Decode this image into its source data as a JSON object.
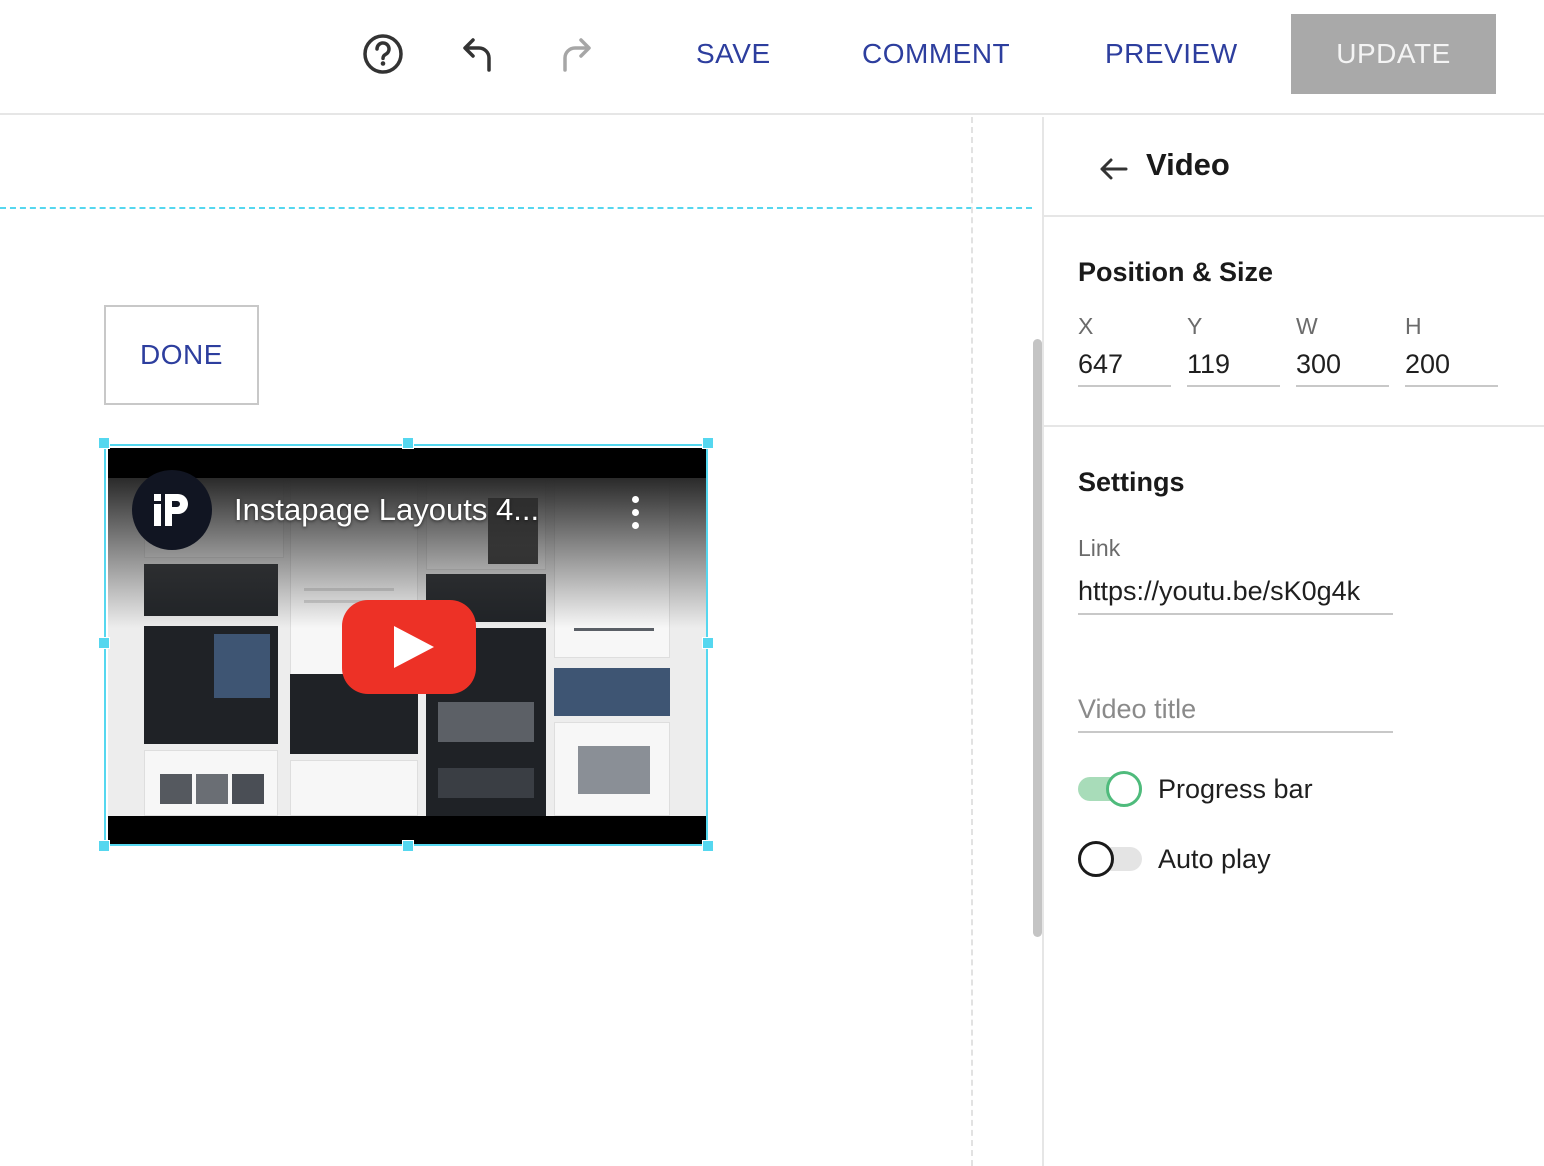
{
  "toolbar": {
    "help_icon": "help-circle-icon",
    "undo_icon": "undo-icon",
    "redo_icon": "redo-icon",
    "save_label": "SAVE",
    "comment_label": "COMMENT",
    "preview_label": "PREVIEW",
    "update_label": "UPDATE"
  },
  "canvas": {
    "done_label": "DONE",
    "video": {
      "title": "Instapage Layouts 4...",
      "channel_icon": "instapage-logo-icon",
      "play_icon": "youtube-play-icon"
    }
  },
  "panel": {
    "back_icon": "arrow-left-icon",
    "title": "Video",
    "position_size": {
      "title": "Position & Size",
      "fields": [
        {
          "label": "X",
          "value": "647"
        },
        {
          "label": "Y",
          "value": "119"
        },
        {
          "label": "W",
          "value": "300"
        },
        {
          "label": "H",
          "value": "200"
        }
      ]
    },
    "settings": {
      "title": "Settings",
      "link_label": "Link",
      "link_value": "https://youtu.be/sK0g4k",
      "video_title_placeholder": "Video title",
      "video_title_value": "",
      "toggles": [
        {
          "label": "Progress bar",
          "on": true
        },
        {
          "label": "Auto play",
          "on": false
        }
      ]
    }
  },
  "colors": {
    "accent_text": "#2d3e9e",
    "selection": "#55d7ef",
    "update_disabled": "#a9a9a9",
    "toggle_on": "#4fbb7c",
    "youtube_red": "#ed3126"
  }
}
